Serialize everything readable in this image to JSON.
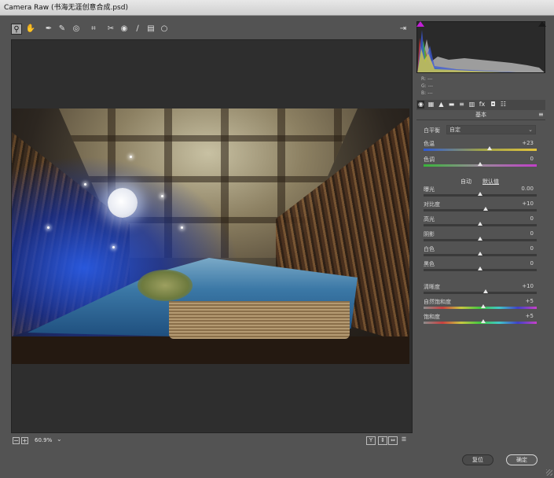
{
  "window": {
    "title": "Camera Raw (书海无涯创意合成.psd)"
  },
  "toolbar": {
    "tools": [
      {
        "name": "zoom-tool",
        "glyph": "⚲",
        "active": true
      },
      {
        "name": "hand-tool",
        "glyph": "✋"
      },
      {
        "name": "white-balance-tool",
        "glyph": "✒"
      },
      {
        "name": "color-sampler-tool",
        "glyph": "✎"
      },
      {
        "name": "targeted-adjustment-tool",
        "glyph": "◎"
      },
      {
        "name": "crop-tool",
        "glyph": "⌗"
      },
      {
        "name": "spot-removal-tool",
        "glyph": "✂"
      },
      {
        "name": "red-eye-tool",
        "glyph": "◉"
      },
      {
        "name": "adjustment-brush-tool",
        "glyph": "∕"
      },
      {
        "name": "graduated-filter-tool",
        "glyph": "▤"
      },
      {
        "name": "radial-filter-tool",
        "glyph": "○"
      }
    ],
    "open_preferences_glyph": "⇥"
  },
  "status_bar": {
    "zoom_value": "60.9%",
    "zoom_out": "−",
    "zoom_in": "+",
    "before_after_y": "Y",
    "view_toggle_a": "⇕",
    "view_toggle_b": "⇔",
    "prefs": "☰"
  },
  "histogram": {
    "r_label": "R:",
    "g_label": "G:",
    "b_label": "B:",
    "r": "---",
    "g": "---",
    "b": "---"
  },
  "panel_tabs": [
    "◉",
    "▦",
    "▲",
    "▬",
    "≡",
    "▥",
    "fx",
    "◘",
    "☷"
  ],
  "panel": {
    "title": "基本",
    "menu_glyph": "≡",
    "white_balance_label": "白平衡",
    "white_balance_value": "自定",
    "auto": "自动",
    "default": "默认值",
    "sliders": [
      {
        "key": "temp",
        "label": "色温",
        "value": "+23",
        "pos": 0.58
      },
      {
        "key": "tint",
        "label": "色调",
        "value": "0",
        "pos": 0.5
      },
      {
        "key": "exposure",
        "label": "曝光",
        "value": "0.00",
        "pos": 0.5
      },
      {
        "key": "contrast",
        "label": "对比度",
        "value": "+10",
        "pos": 0.55
      },
      {
        "key": "highlights",
        "label": "高光",
        "value": "0",
        "pos": 0.5
      },
      {
        "key": "shadows",
        "label": "阴影",
        "value": "0",
        "pos": 0.5
      },
      {
        "key": "whites",
        "label": "白色",
        "value": "0",
        "pos": 0.5
      },
      {
        "key": "blacks",
        "label": "黑色",
        "value": "0",
        "pos": 0.5
      },
      {
        "key": "clarity",
        "label": "清晰度",
        "value": "+10",
        "pos": 0.55
      },
      {
        "key": "vibrance",
        "label": "自然饱和度",
        "value": "+5",
        "pos": 0.525
      },
      {
        "key": "saturation",
        "label": "饱和度",
        "value": "+5",
        "pos": 0.525
      }
    ]
  },
  "buttons": {
    "reset": "复位",
    "ok": "确定"
  }
}
